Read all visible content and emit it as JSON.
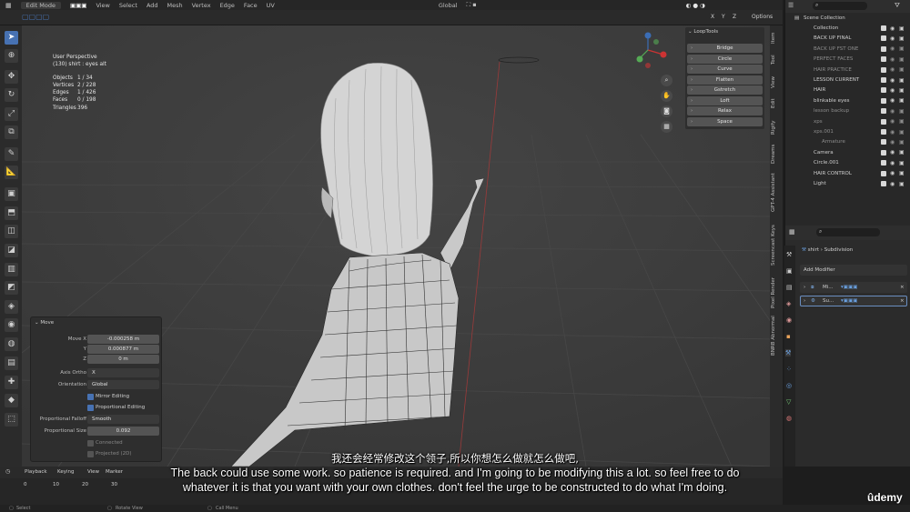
{
  "topbar": {
    "mode": "Edit Mode",
    "menus": [
      "View",
      "Select",
      "Add",
      "Mesh",
      "Vertex",
      "Edge",
      "Face",
      "UV"
    ],
    "orientation": "Global",
    "options": "Options",
    "axes": [
      "X",
      "Y",
      "Z"
    ]
  },
  "viewport": {
    "view_name": "User Perspective",
    "object_name": "(130) shirt : eyes alt",
    "stats": [
      {
        "label": "Objects",
        "value": "1 / 34"
      },
      {
        "label": "Vertices",
        "value": "2 / 228"
      },
      {
        "label": "Edges",
        "value": "1 / 426"
      },
      {
        "label": "Faces",
        "value": "0 / 198"
      },
      {
        "label": "Triangles",
        "value": "396"
      }
    ]
  },
  "looptools": {
    "title": "LoopTools",
    "buttons": [
      "Bridge",
      "Circle",
      "Curve",
      "Flatten",
      "Gstretch",
      "Loft",
      "Relax",
      "Space"
    ]
  },
  "side_tabs": [
    "Item",
    "Tool",
    "View",
    "Edit",
    "Rigify",
    "Dreams",
    "GPT-4 Assistant",
    "Screencast Keys",
    "Pixel Render",
    "BNRB Abnormal"
  ],
  "move_panel": {
    "title": "Move",
    "move_x_label": "Move X",
    "move_x": "-0.000258 m",
    "y_label": "Y",
    "y": "0.000877 m",
    "z_label": "Z",
    "z": "0 m",
    "axis_ortho_label": "Axis Ortho",
    "axis_ortho": "X",
    "orientation_label": "Orientation",
    "orientation": "Global",
    "mirror_editing": "Mirror Editing",
    "proportional_editing": "Proportional Editing",
    "falloff_label": "Proportional Falloff",
    "falloff": "Smooth",
    "size_label": "Proportional Size",
    "size": "0.092",
    "connected": "Connected",
    "projected": "Projected (2D)"
  },
  "outliner": {
    "root": "Scene Collection",
    "items": [
      "Collection",
      "BACK UP FINAL",
      "BACK UP FST ONE",
      "PERFECT FACES",
      "HAIR PRACTICE",
      "LESSON CURRENT",
      "HAIR",
      "blinkable eyes",
      "lesson backup",
      "xps",
      "xps.001",
      "Armature",
      "Camera",
      "Circle.001",
      "HAIR CONTROL",
      "Light"
    ]
  },
  "properties": {
    "object": "shirt",
    "modifier": "Subdivision",
    "add_modifier": "Add Modifier",
    "modifiers": [
      "Mi...",
      "Su..."
    ]
  },
  "timeline": {
    "menus": [
      "Playback",
      "Keying",
      "View",
      "Marker"
    ],
    "frames": [
      "0",
      "10",
      "20",
      "30"
    ]
  },
  "status": {
    "left": "Select",
    "middle": "Rotate View",
    "right": "Call Menu"
  },
  "subtitles": {
    "zh": "我还会经常修改这个领子,所以你想怎么做就怎么做吧,",
    "en1": "The back could use some work. so patience is required. and I'm going to be modifying this a lot. so feel free to do",
    "en2": "whatever it is that you want with your own clothes. don't feel the urge to be constructed to do what I'm doing."
  },
  "watermark": "ûdemy"
}
